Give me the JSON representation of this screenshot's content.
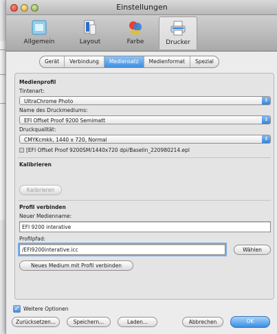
{
  "window": {
    "title": "Einstellungen"
  },
  "toolbar": {
    "items": [
      {
        "label": "Allgemein",
        "icon": "general-icon"
      },
      {
        "label": "Layout",
        "icon": "layout-icon"
      },
      {
        "label": "Farbe",
        "icon": "color-icon"
      },
      {
        "label": "Drucker",
        "icon": "printer-icon",
        "selected": true
      }
    ]
  },
  "tabs": [
    {
      "label": "Gerät"
    },
    {
      "label": "Verbindung"
    },
    {
      "label": "Mediensatz",
      "selected": true
    },
    {
      "label": "Medienformat"
    },
    {
      "label": "Spezial"
    }
  ],
  "medienprofil": {
    "heading": "Medienprofil",
    "tintenart_label": "Tintenart:",
    "tintenart_value": "UltraChrome Photo",
    "druckmedium_label": "Name des Druckmediums:",
    "druckmedium_value": "EFI Offset Proof 9200 Semimatt",
    "druckqualitaet_label": "Druckqualität:",
    "druckqualitaet_value": "CMYKcmkk, 1440 x 720, Normal",
    "profile_path": "[EFI Offset Proof 9200SM/1440x720 dpi/Baselin_220980214.epl"
  },
  "kalibrieren": {
    "heading": "Kalibrieren",
    "button": "Kalibrieren"
  },
  "profil_verbinden": {
    "heading": "Profil verbinden",
    "name_label": "Neuer Medienname:",
    "name_value": "EFI 9200 interative",
    "pfad_label": "Profilpfad:",
    "pfad_value": "/EFI9200interative.icc",
    "waehlen_button": "Wählen",
    "connect_button": "Neues Medium mit Profil verbinden"
  },
  "footer": {
    "weitere_optionen": "Weitere Optionen",
    "weitere_checked": true,
    "reset_button": "Zurücksetzen...",
    "save_button": "Speichern...",
    "load_button": "Laden...",
    "cancel_button": "Abbrechen",
    "ok_button": "OK"
  },
  "colors": {
    "accent": "#3f8fe0",
    "window_bg": "#e9e9e9"
  }
}
